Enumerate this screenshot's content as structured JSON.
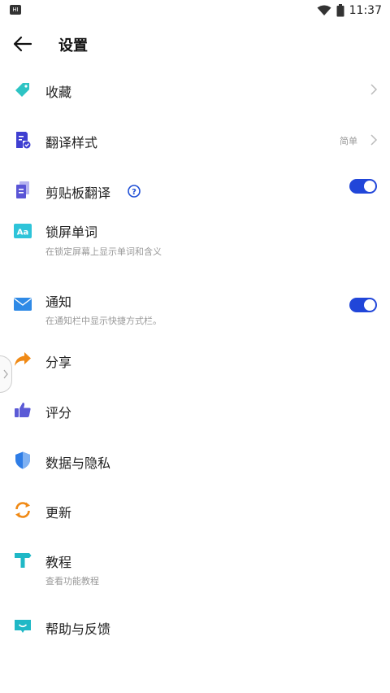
{
  "status_bar": {
    "left_badge": "HI",
    "time": "11:37"
  },
  "header": {
    "title": "设置"
  },
  "items": [
    {
      "label": "收藏"
    },
    {
      "label": "翻译样式",
      "value": "简单"
    },
    {
      "label": "剪贴板翻译"
    },
    {
      "label": "锁屏单词",
      "sub": "在锁定屏幕上显示单词和含义"
    },
    {
      "label": "通知",
      "sub": "在通知栏中显示快捷方式栏。"
    },
    {
      "label": "分享"
    },
    {
      "label": "评分"
    },
    {
      "label": "数据与隐私"
    },
    {
      "label": "更新"
    },
    {
      "label": "教程",
      "sub": "查看功能教程"
    },
    {
      "label": "帮助与反馈"
    }
  ],
  "toggles": {
    "clipboard_translate": true,
    "notification": true
  },
  "colors": {
    "accent": "#2146d9",
    "tag_icon": "#2ec4c4",
    "style_icon": "#3f3fd1",
    "clipboard_icon": "#5a55d6",
    "lockscreen_icon": "#2ec4d9",
    "mail_icon": "#2f8ae6",
    "share_icon": "#f08a16",
    "rate_icon": "#5b5ad6",
    "privacy_icon": "#2f7de6",
    "update_icon": "#f08a16",
    "tutorial_icon": "#1fb8c6",
    "help_icon": "#1fb8c6"
  },
  "icons": {
    "back": "arrow-left-icon",
    "favorites": "tag-icon",
    "style": "document-check-icon",
    "clipboard": "clipboard-icon",
    "help": "question-circle-icon",
    "lockscreen": "aa-text-icon",
    "notification": "mail-icon",
    "share": "share-arrow-icon",
    "rate": "thumbs-up-icon",
    "privacy": "shield-icon",
    "update": "refresh-icon",
    "tutorial": "signpost-icon",
    "feedback": "chat-bubble-icon"
  }
}
